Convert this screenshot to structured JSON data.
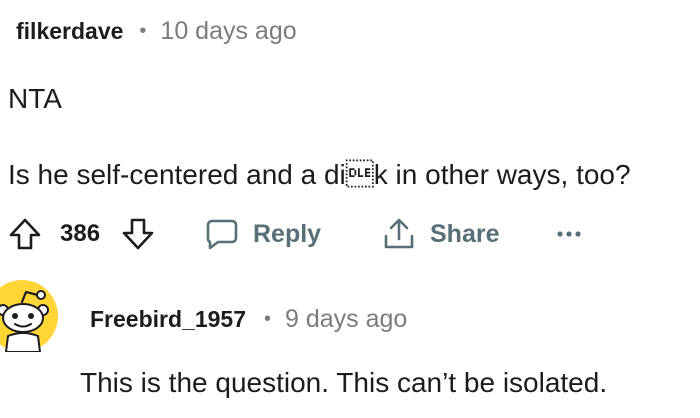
{
  "comment": {
    "author": "filkerdave",
    "separator": "•",
    "timestamp": "10 days ago",
    "body_line1": "NTA",
    "body_line2": "Is he self-centered and a di\u0010k in other ways, too?",
    "actions": {
      "upvote_icon": "upvote-arrow-icon",
      "score": "386",
      "downvote_icon": "downvote-arrow-icon",
      "reply_label": "Reply",
      "reply_icon": "speech-bubble-icon",
      "share_label": "Share",
      "share_icon": "share-upload-icon",
      "more_label": "•••"
    }
  },
  "reply": {
    "avatar_icon": "reddit-snoo-avatar-icon",
    "avatar_color": "#FFD635",
    "author": "Freebird_1957",
    "separator": "•",
    "timestamp": "9 days ago",
    "body": "This is the question. This can’t be isolated."
  },
  "colors": {
    "text_primary": "#1C1C1C",
    "text_meta": "#7C7C7C",
    "action_gray": "#576F76"
  }
}
